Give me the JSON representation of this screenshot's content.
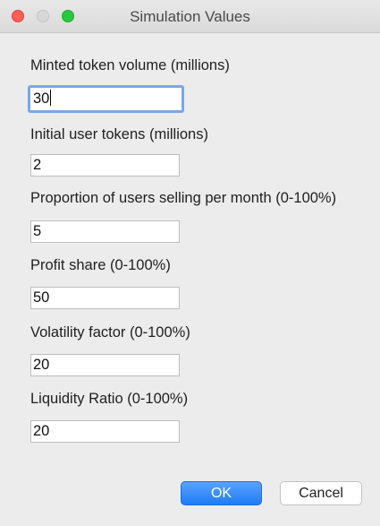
{
  "window": {
    "title": "Simulation Values"
  },
  "form": {
    "fields": [
      {
        "label": "Minted token volume (millions)",
        "value": "30"
      },
      {
        "label": "Initial user tokens (millions)",
        "value": "2"
      },
      {
        "label": "Proportion of users selling per month (0-100%)",
        "value": "5"
      },
      {
        "label": "Profit share (0-100%)",
        "value": "50"
      },
      {
        "label": "Volatility factor (0-100%)",
        "value": "20"
      },
      {
        "label": "Liquidity Ratio (0-100%)",
        "value": "20"
      }
    ]
  },
  "buttons": {
    "ok_label": "OK",
    "cancel_label": "Cancel"
  },
  "colors": {
    "accent": "#1f7cf5",
    "focus_ring": "#7aa7e6",
    "close": "#fc5f57",
    "maximize": "#29c740"
  }
}
